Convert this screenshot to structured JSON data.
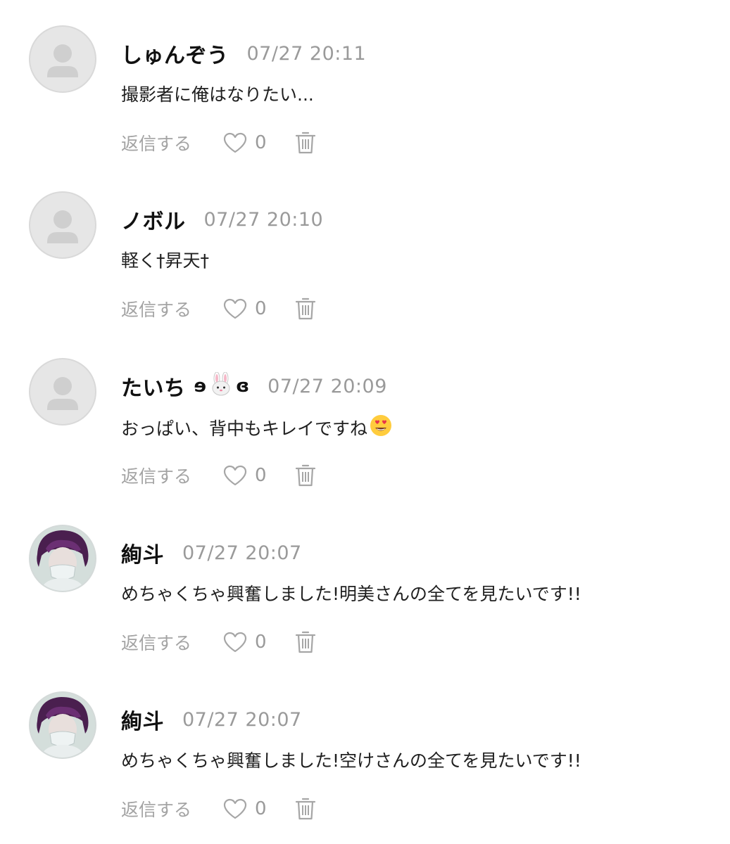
{
  "colors": {
    "name": "#111111",
    "timestamp": "#9a9a9a",
    "action": "#a3a3a3",
    "avatar_bg": "#e6e6e6",
    "avatar_glyph": "#cfcfcf"
  },
  "comments": [
    {
      "user_name": "しゅんぞう",
      "name_decoration": null,
      "timestamp": "07/27 20:11",
      "text": "撮影者に俺はなりたい...",
      "avatar_type": "default",
      "reply_label": "返信する",
      "like_count": "0"
    },
    {
      "user_name": "ノボル",
      "name_decoration": null,
      "timestamp": "07/27 20:10",
      "text": "軽く†昇天†",
      "avatar_type": "default",
      "reply_label": "返信する",
      "like_count": "0"
    },
    {
      "user_name": "たいち",
      "name_decoration": {
        "left": "ɘ",
        "emoji": "🐰",
        "right": "ɞ"
      },
      "timestamp": "07/27 20:09",
      "text": "おっぱい、背中もキレイですね",
      "text_emoji": "😍",
      "avatar_type": "default",
      "reply_label": "返信する",
      "like_count": "0"
    },
    {
      "user_name": "絢斗",
      "name_decoration": null,
      "timestamp": "07/27 20:07",
      "text": "めちゃくちゃ興奮しました!明美さんの全てを見たいです!!",
      "avatar_type": "photo",
      "reply_label": "返信する",
      "like_count": "0"
    },
    {
      "user_name": "絢斗",
      "name_decoration": null,
      "timestamp": "07/27 20:07",
      "text": "めちゃくちゃ興奮しました!空けさんの全てを見たいです!!",
      "avatar_type": "photo",
      "reply_label": "返信する",
      "like_count": "0"
    }
  ],
  "icons": {
    "like": "heart-outline",
    "delete": "trash-can",
    "avatar_default": "person-silhouette"
  }
}
